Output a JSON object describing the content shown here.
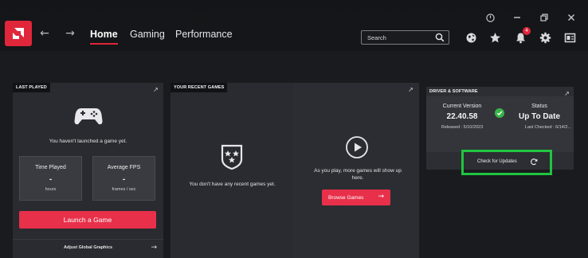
{
  "window": {
    "controls": [
      "power-icon",
      "minimize-icon",
      "restore-icon",
      "close-icon"
    ]
  },
  "nav": {
    "tabs": [
      {
        "label": "Home",
        "active": true
      },
      {
        "label": "Gaming",
        "active": false
      },
      {
        "label": "Performance",
        "active": false
      }
    ],
    "search_placeholder": "Search",
    "notification_count": "4"
  },
  "last_played": {
    "header": "LAST PLAYED",
    "message": "You haven't launched a game yet.",
    "time_played": {
      "label": "Time Played",
      "value": "-",
      "unit": "hours"
    },
    "average_fps": {
      "label": "Average FPS",
      "value": "-",
      "unit": "frames / sec"
    },
    "launch_label": "Launch a Game",
    "adjust_label": "Adjust Global Graphics"
  },
  "recent_games": {
    "header": "YOUR RECENT GAMES",
    "empty_message": "You don't have any recent games yet.",
    "play_message": "As you play, more games will show up here.",
    "browse_label": "Browse Games"
  },
  "driver": {
    "header": "DRIVER & SOFTWARE",
    "current_version_label": "Current Version",
    "version": "22.40.58",
    "released": "Released : 5/10/2023",
    "status_label": "Status",
    "status": "Up To Date",
    "last_checked": "Last Checked : 6/14/2...",
    "check_updates_label": "Check for Updates"
  },
  "colors": {
    "accent": "#e0263a",
    "button": "#e8304a",
    "success": "#39b54a",
    "highlight": "#1fc640"
  }
}
